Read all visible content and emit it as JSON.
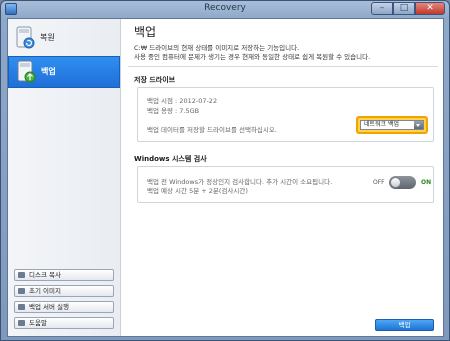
{
  "window": {
    "title": "Recovery"
  },
  "titlebar": {
    "minimize": "–",
    "maximize": "□",
    "close": "✕"
  },
  "sidebar": {
    "items": [
      {
        "label": "복원"
      },
      {
        "label": "백업"
      }
    ],
    "buttons": [
      {
        "label": "디스크 복사"
      },
      {
        "label": "초기 이미지"
      },
      {
        "label": "백업 서버 실행"
      },
      {
        "label": "도움말"
      }
    ]
  },
  "main": {
    "title": "백업",
    "description_line1": "C:₩ 드라이브의 현재 상태를 이미지로 저장하는 기능입니다.",
    "description_line2": "사용 중인 컴퓨터에 문제가 생기는 경우 현재와 동일한 상태로 쉽게 복원할 수 있습니다.",
    "storage": {
      "title": "저장 드라이브",
      "backup_time": "백업 시점 : 2012-07-22",
      "backup_size": "백업 용량 : 7.5GB",
      "select_prompt": "백업 데이터를 저장할 드라이브를 선택하십시오.",
      "selected_drive": "네트워크 백업"
    },
    "check": {
      "title": "Windows 시스템 검사",
      "line1": "백업 전 Windows가 정상인지 검사합니다. 추가 시간이 소요됩니다.",
      "line2": "백업 예상 시간 5분 + 2분(검사시간)",
      "toggle_off_label": "OFF",
      "toggle_on_label": "ON"
    },
    "primary_button": "백업"
  }
}
